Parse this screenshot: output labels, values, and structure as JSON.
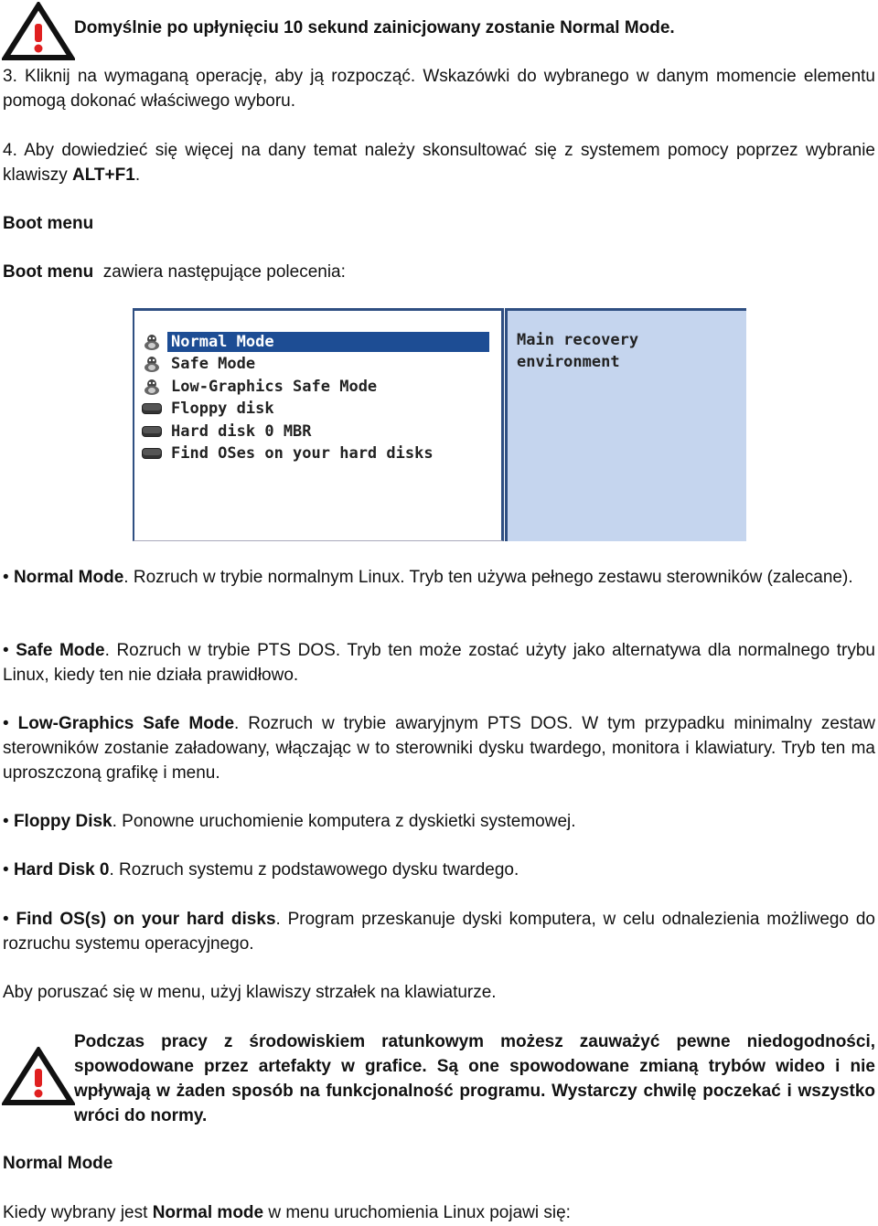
{
  "note_top": {
    "icon": "warning-icon",
    "text": "Domyślnie po upłynięciu 10 sekund zainicjowany zostanie Normal Mode."
  },
  "step3": "3. Kliknij na wymaganą operację, aby ją rozpocząć. Wskazówki do wybranego w danym momencie elementu pomogą dokonać właściwego wyboru.",
  "step4": {
    "before": "4. Aby dowiedzieć się więcej na dany temat należy skonsultować się z systemem pomocy poprzez wybranie klawiszy ",
    "key": "ALT+F1",
    "after": "."
  },
  "heading_boot_menu": "Boot menu",
  "boot_intro": {
    "bold": "Boot menu",
    "rest": "  zawiera następujące polecenia:"
  },
  "boot_screen": {
    "items": [
      {
        "label": "Normal Mode",
        "icon": "linux-penguin-icon",
        "selected": true
      },
      {
        "label": "Safe Mode",
        "icon": "linux-penguin-icon",
        "selected": false
      },
      {
        "label": "Low-Graphics Safe Mode",
        "icon": "linux-penguin-icon",
        "selected": false
      },
      {
        "label": "Floppy disk",
        "icon": "disk-drive-icon",
        "selected": false
      },
      {
        "label": "Hard disk 0 MBR",
        "icon": "disk-drive-icon",
        "selected": false
      },
      {
        "label": "Find OSes on your hard disks",
        "icon": "disk-drive-icon",
        "selected": false
      }
    ],
    "description_line1": "Main recovery",
    "description_line2": "environment",
    "colors": {
      "selected_bg": "#1d4d94",
      "panel_bg": "#c5d5ee",
      "border": "#2f4f82"
    }
  },
  "bullets": [
    {
      "bold": "Normal Mode",
      "text": ". Rozruch w trybie normalnym Linux. Tryb ten używa pełnego zestawu sterowników (zalecane)."
    },
    {
      "bold": "Safe Mode",
      "text": ". Rozruch w trybie PTS DOS. Tryb ten może zostać użyty jako alternatywa dla normalnego trybu Linux, kiedy ten nie działa prawidłowo."
    },
    {
      "bold": "Low-Graphics Safe Mode",
      "text": ". Rozruch w trybie awaryjnym PTS DOS. W tym przypadku minimalny zestaw sterowników zostanie załadowany, włączając w to sterowniki dysku twardego, monitora i klawiatury. Tryb ten ma uproszczoną grafikę i menu."
    },
    {
      "bold": "Floppy Disk",
      "text": ". Ponowne uruchomienie komputera z dyskietki systemowej."
    },
    {
      "bold": "Hard Disk 0",
      "text": ". Rozruch systemu z podstawowego dysku twardego."
    },
    {
      "bold": "Find OS(s) on your hard disks",
      "text": ". Program przeskanuje dyski komputera, w celu odnalezienia możliwego do rozruchu systemu operacyjnego."
    }
  ],
  "bullet_char": "•",
  "nav_hint": "Aby poruszać się w menu, użyj klawiszy strzałek na klawiaturze.",
  "note_bottom": {
    "icon": "warning-icon",
    "text": "Podczas pracy z środowiskiem ratunkowym możesz zauważyć pewne niedogodności, spowodowane przez artefakty w grafice. Są one spowodowane zmianą trybów wideo i nie wpływają w żaden sposób na funkcjonalność programu. Wystarczy chwilę poczekać i wszystko wróci do normy."
  },
  "heading_normal_mode": "Normal Mode",
  "final": {
    "before": "Kiedy wybrany jest ",
    "bold": "Normal mode",
    "after": " w menu uruchomienia Linux pojawi się:"
  }
}
